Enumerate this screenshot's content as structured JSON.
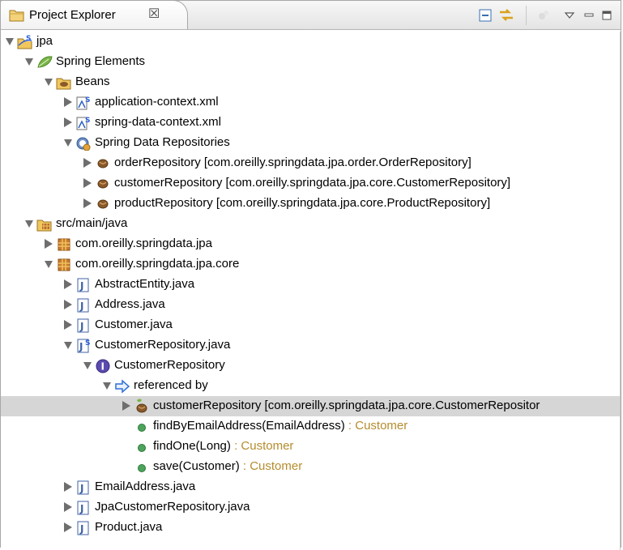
{
  "view": {
    "title": "Project Explorer",
    "close_glyph": "☒",
    "toolbar": [
      {
        "name": "collapse-all-icon",
        "label": "Collapse All"
      },
      {
        "name": "link-with-editor-icon",
        "label": "Link with Editor"
      },
      {
        "name": "view-menu-icon",
        "label": "View Menu"
      },
      {
        "name": "minimize-icon",
        "label": "Minimize"
      },
      {
        "name": "maximize-icon",
        "label": "Maximize"
      }
    ]
  },
  "tree": [
    {
      "label": "jpa",
      "depth": 0,
      "expander": "open",
      "icon": "project-icon"
    },
    {
      "label": "Spring Elements",
      "depth": 1,
      "expander": "open",
      "icon": "spring-leaf-icon"
    },
    {
      "label": "Beans",
      "depth": 2,
      "expander": "open",
      "icon": "beans-folder-icon"
    },
    {
      "label": "application-context.xml",
      "depth": 3,
      "expander": "closed",
      "icon": "spring-xml-icon"
    },
    {
      "label": "spring-data-context.xml",
      "depth": 3,
      "expander": "closed",
      "icon": "spring-xml-icon"
    },
    {
      "label": "Spring Data Repositories",
      "depth": 3,
      "expander": "open",
      "icon": "spring-data-icon"
    },
    {
      "label": "orderRepository [com.oreilly.springdata.jpa.order.OrderRepository]",
      "depth": 4,
      "expander": "closed",
      "icon": "bean-icon"
    },
    {
      "label": "customerRepository [com.oreilly.springdata.jpa.core.CustomerRepository]",
      "depth": 4,
      "expander": "closed",
      "icon": "bean-icon"
    },
    {
      "label": "productRepository [com.oreilly.springdata.jpa.core.ProductRepository]",
      "depth": 4,
      "expander": "closed",
      "icon": "bean-icon"
    },
    {
      "label": "src/main/java",
      "depth": 1,
      "expander": "open",
      "icon": "source-folder-icon"
    },
    {
      "label": "com.oreilly.springdata.jpa",
      "depth": 2,
      "expander": "closed",
      "icon": "package-icon"
    },
    {
      "label": "com.oreilly.springdata.jpa.core",
      "depth": 2,
      "expander": "open",
      "icon": "package-icon"
    },
    {
      "label": "AbstractEntity.java",
      "depth": 3,
      "expander": "closed",
      "icon": "java-file-icon"
    },
    {
      "label": "Address.java",
      "depth": 3,
      "expander": "closed",
      "icon": "java-file-icon"
    },
    {
      "label": "Customer.java",
      "depth": 3,
      "expander": "closed",
      "icon": "java-file-icon"
    },
    {
      "label": "CustomerRepository.java",
      "depth": 3,
      "expander": "open",
      "icon": "java-spring-file-icon"
    },
    {
      "label": "CustomerRepository",
      "depth": 4,
      "expander": "open",
      "icon": "interface-icon"
    },
    {
      "label": "referenced by",
      "depth": 5,
      "expander": "open",
      "icon": "referenced-by-icon"
    },
    {
      "label": "customerRepository [com.oreilly.springdata.jpa.core.CustomerRepositor",
      "depth": 6,
      "expander": "closed",
      "icon": "spring-bean-icon",
      "selected": true
    },
    {
      "label": "findByEmailAddress(EmailAddress)",
      "decoration": " : Customer",
      "depth": 6,
      "expander": "none",
      "icon": "method-icon"
    },
    {
      "label": "findOne(Long)",
      "decoration": " : Customer",
      "depth": 6,
      "expander": "none",
      "icon": "method-icon"
    },
    {
      "label": "save(Customer)",
      "decoration": " : Customer",
      "depth": 6,
      "expander": "none",
      "icon": "method-icon"
    },
    {
      "label": "EmailAddress.java",
      "depth": 3,
      "expander": "closed",
      "icon": "java-file-icon"
    },
    {
      "label": "JpaCustomerRepository.java",
      "depth": 3,
      "expander": "closed",
      "icon": "java-file-icon"
    },
    {
      "label": "Product.java",
      "depth": 3,
      "expander": "closed",
      "icon": "java-file-icon"
    }
  ],
  "colors": {
    "selection": "#d6d6d6",
    "decoration": "#b58c2e",
    "method": "#4ea35c"
  }
}
